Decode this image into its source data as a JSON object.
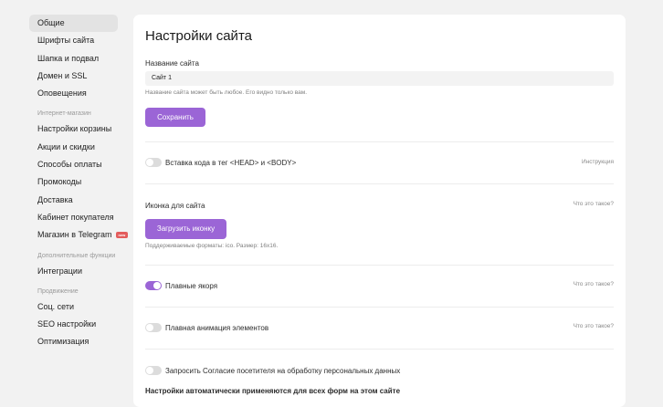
{
  "sidebar": {
    "items_main": [
      "Общие",
      "Шрифты сайта",
      "Шапка и подвал",
      "Домен и SSL",
      "Оповещения"
    ],
    "group_shop": "Интернет-магазин",
    "items_shop": [
      "Настройки корзины",
      "Акции и скидки",
      "Способы оплаты",
      "Промокоды",
      "Доставка",
      "Кабинет покупателя",
      "Магазин в Telegram"
    ],
    "telegram_badge": "new",
    "group_extra": "Дополнительные функции",
    "items_extra": [
      "Интеграции"
    ],
    "group_promo": "Продвижение",
    "items_promo": [
      "Соц. сети",
      "SEO настройки",
      "Оптимизация"
    ]
  },
  "main": {
    "title": "Настройки сайта",
    "site_name_label": "Название сайта",
    "site_name_value": "Сайт 1",
    "site_name_hint": "Название сайта может быть любое. Его видно только вам.",
    "save_button": "Сохранить",
    "code_insert_label": "Вставка кода в тег <HEAD> и <BODY>",
    "code_insert_link": "Инструкция",
    "code_insert_on": false,
    "icon_label": "Иконка для сайта",
    "icon_link": "Что это такое?",
    "upload_button": "Загрузить иконку",
    "icon_hint": "Поддерживаемые форматы: ico. Размер: 16x16.",
    "anchors_label": "Плавные якоря",
    "anchors_link": "Что это такое?",
    "anchors_on": true,
    "animation_label": "Плавная анимация элементов",
    "animation_link": "Что это такое?",
    "animation_on": false,
    "consent_label": "Запросить Согласие посетителя на обработку персональных данных",
    "consent_on": false,
    "auto_apply_note": "Настройки автоматически применяются для всех форм на этом сайте"
  },
  "colors": {
    "accent": "#9b65d6",
    "toggle_off": "#dcdcdc",
    "background": "#f2f2f2"
  }
}
